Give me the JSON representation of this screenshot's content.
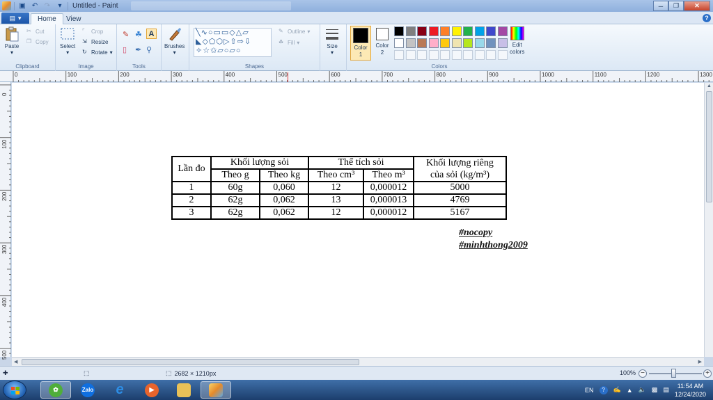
{
  "window": {
    "title": "Untitled - Paint"
  },
  "tabs": {
    "file_icon": "menu-icon",
    "home": "Home",
    "view": "View"
  },
  "clipboard": {
    "paste": "Paste",
    "cut": "Cut",
    "copy": "Copy",
    "label": "Clipboard"
  },
  "image": {
    "select": "Select",
    "crop": "Crop",
    "resize": "Resize",
    "rotate": "Rotate",
    "label": "Image"
  },
  "tools": {
    "label": "Tools"
  },
  "brushes": {
    "label": "Brushes"
  },
  "shapes": {
    "label": "Shapes",
    "outline": "Outline",
    "fill": "Fill"
  },
  "size": {
    "label": "Size"
  },
  "colors": {
    "color1": "Color\n1",
    "color1_value": "#000000",
    "color2": "Color\n2",
    "color2_value": "#ffffff",
    "edit": "Edit\ncolors",
    "label": "Colors",
    "palette_row1": [
      "#000000",
      "#7f7f7f",
      "#880015",
      "#ed1c24",
      "#ff7f27",
      "#fff200",
      "#22b14c",
      "#00a2e8",
      "#3f48cc",
      "#a349a4"
    ],
    "palette_row2": [
      "#ffffff",
      "#c3c3c3",
      "#b97a57",
      "#ffaec9",
      "#ffc90e",
      "#efe4b0",
      "#b5e61d",
      "#99d9ea",
      "#7092be",
      "#c8bfe7"
    ]
  },
  "ruler": {
    "top": [
      "0",
      "100",
      "200",
      "300",
      "400",
      "500",
      "600",
      "700",
      "800",
      "900",
      "1000",
      "1100",
      "1200",
      "1300"
    ],
    "left": [
      "0",
      "100",
      "200",
      "300",
      "400",
      "500"
    ]
  },
  "table": {
    "h_lan_do": "Lần đo",
    "h_khoi_luong": "Khối lượng sỏi",
    "h_the_tich": "Thể tích sỏi",
    "h_klr_line1": "Khối lượng riêng",
    "h_klr_line2": "của sỏi (kg/m³)",
    "sub_g": "Theo g",
    "sub_kg": "Theo kg",
    "sub_cm3": "Theo cm³",
    "sub_m3": "Theo m³",
    "rows": [
      {
        "lan": "1",
        "g": "60g",
        "kg": "0,060",
        "cm3": "12",
        "m3": "0,000012",
        "klr": "5000"
      },
      {
        "lan": "2",
        "g": "62g",
        "kg": "0,062",
        "cm3": "13",
        "m3": "0,000013",
        "klr": "4769"
      },
      {
        "lan": "3",
        "g": "62g",
        "kg": "0,062",
        "cm3": "12",
        "m3": "0,000012",
        "klr": "5167"
      }
    ]
  },
  "tags": {
    "tag1": "#nocopy",
    "tag2": "#minhthong2009"
  },
  "status": {
    "image_size": "2682 × 1210px",
    "zoom": "100%"
  },
  "taskbar": {
    "zalo": "Zalo",
    "language": "EN",
    "time": "11:54 AM",
    "date": "12/24/2020"
  }
}
